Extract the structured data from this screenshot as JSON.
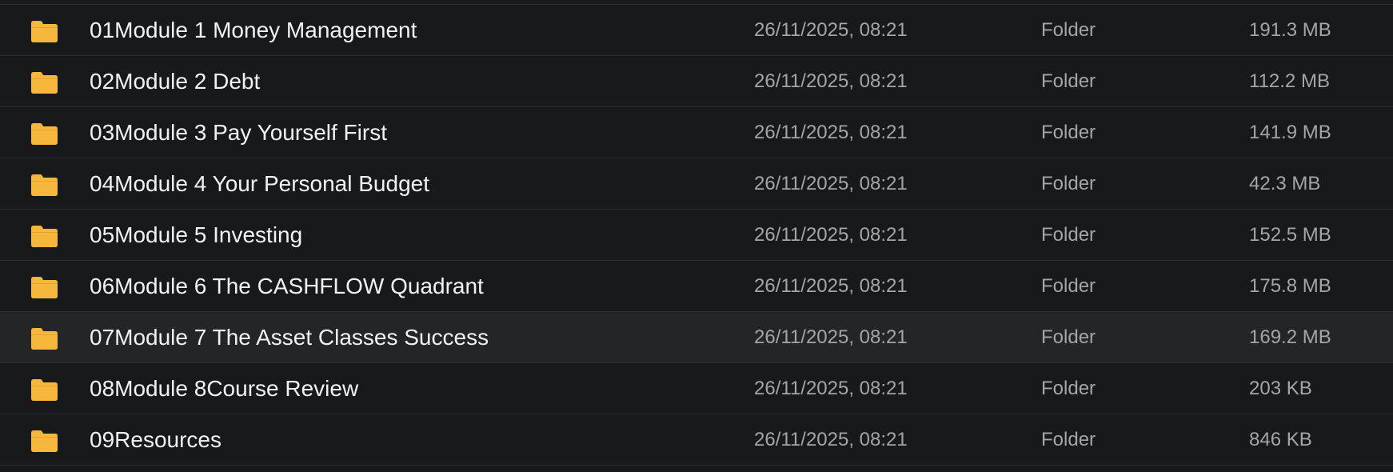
{
  "file_list": {
    "rows": [
      {
        "name": "01Module 1 Money Management",
        "modified": "26/11/2025, 08:21",
        "kind": "Folder",
        "size": "191.3 MB",
        "icon": "folder-icon"
      },
      {
        "name": "02Module 2 Debt",
        "modified": "26/11/2025, 08:21",
        "kind": "Folder",
        "size": "112.2 MB",
        "icon": "folder-icon"
      },
      {
        "name": "03Module 3 Pay Yourself First",
        "modified": "26/11/2025, 08:21",
        "kind": "Folder",
        "size": "141.9 MB",
        "icon": "folder-icon"
      },
      {
        "name": "04Module 4 Your Personal Budget",
        "modified": "26/11/2025, 08:21",
        "kind": "Folder",
        "size": "42.3 MB",
        "icon": "folder-icon"
      },
      {
        "name": "05Module 5 Investing",
        "modified": "26/11/2025, 08:21",
        "kind": "Folder",
        "size": "152.5 MB",
        "icon": "folder-icon"
      },
      {
        "name": "06Module 6 The CASHFLOW Quadrant",
        "modified": "26/11/2025, 08:21",
        "kind": "Folder",
        "size": "175.8 MB",
        "icon": "folder-icon"
      },
      {
        "name": "07Module 7 The Asset Classes Success",
        "modified": "26/11/2025, 08:21",
        "kind": "Folder",
        "size": "169.2 MB",
        "icon": "folder-icon"
      },
      {
        "name": "08Module 8Course Review",
        "modified": "26/11/2025, 08:21",
        "kind": "Folder",
        "size": "203 KB",
        "icon": "folder-icon"
      },
      {
        "name": "09Resources",
        "modified": "26/11/2025, 08:21",
        "kind": "Folder",
        "size": "846 KB",
        "icon": "folder-icon"
      }
    ]
  },
  "colors": {
    "background": "#17191a",
    "row_highlight": "#232527",
    "divider": "#2a2d2f",
    "name_text": "#f2f2f2",
    "meta_text": "#a3a6a8",
    "folder": "#f5b83d"
  }
}
